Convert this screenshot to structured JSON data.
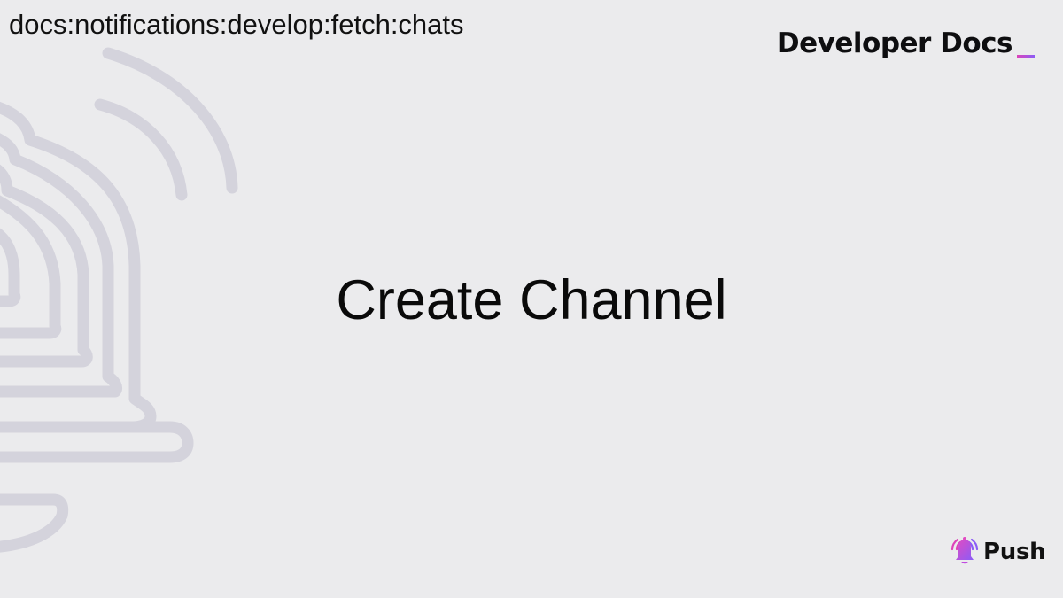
{
  "breadcrumb": "docs:notifications:develop:fetch:chats",
  "brand": {
    "label": "Developer Docs",
    "cursor": "_"
  },
  "title": "Create Channel",
  "logo": {
    "icon": "bell-icon",
    "label": "Push"
  },
  "background": {
    "icon": "bell-outline-icon"
  },
  "colors": {
    "background": "#ebebed",
    "outline": "#d4d3dc",
    "accent_pink": "#dd44b9",
    "accent_purple": "#8b5cf6",
    "text": "#0a0a0a"
  }
}
